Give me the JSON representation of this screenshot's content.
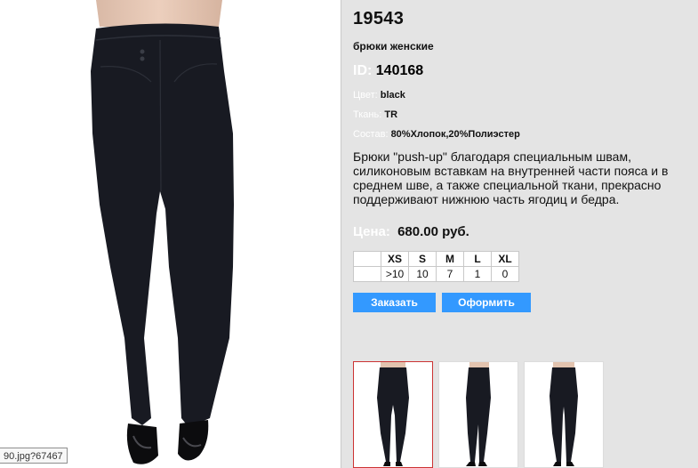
{
  "product": {
    "sku": "19543",
    "type": "брюки женские",
    "id_label": "ID:",
    "id_value": "140168",
    "color_label": "Цвет:",
    "color_value": "black",
    "fabric_label": "Ткань:",
    "fabric_value": "TR",
    "composition_label": "Состав:",
    "composition_value": "80%Хлопок,20%Полиэстер",
    "description": "Брюки \"push-up\" благодаря специальным швам, силиконовым вставкам на внутренней части пояса и в среднем шве, а также специальной ткани, прекрасно поддерживают нижнюю часть ягодиц и бедра.",
    "price_label": "Цена:",
    "price_value": "680.00 руб."
  },
  "sizes": {
    "headers": [
      "XS",
      "S",
      "M",
      "L",
      "XL"
    ],
    "stock": [
      ">10",
      "10",
      "7",
      "1",
      "0"
    ]
  },
  "buttons": {
    "order": "Заказать",
    "checkout": "Оформить"
  },
  "status_url": "90.jpg?67467",
  "thumbnails": [
    {
      "view": "front",
      "selected": true
    },
    {
      "view": "side",
      "selected": false
    },
    {
      "view": "back",
      "selected": false
    }
  ],
  "colors": {
    "accent": "#3399ff",
    "selected_border": "#cc3333",
    "panel_bg": "#e4e4e4"
  }
}
